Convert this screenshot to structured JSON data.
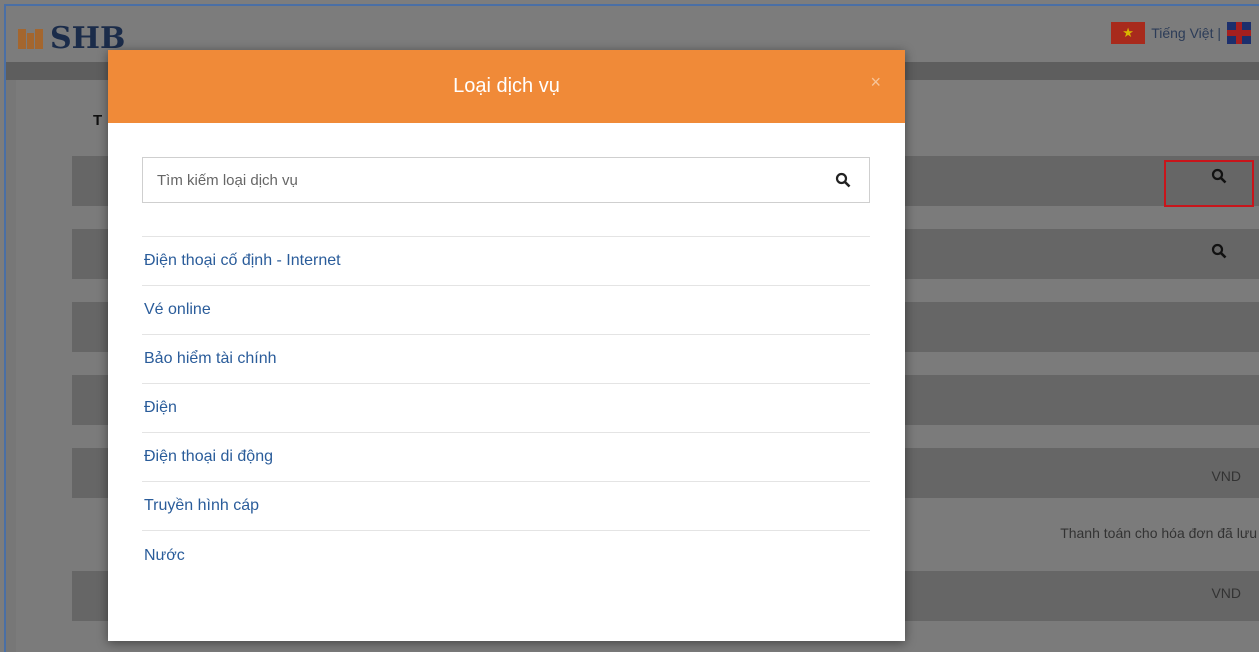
{
  "header": {
    "logo_text": "SHB",
    "language_label": "Tiếng Việt |"
  },
  "background": {
    "breadcrumb": "T",
    "rows": [
      {
        "text": ""
      },
      {
        "text": ""
      },
      {
        "text": ""
      },
      {
        "text": ""
      },
      {
        "text": "VND"
      },
      {
        "text": "Thanh toán cho hóa đơn đã lưu"
      },
      {
        "text": "VND"
      }
    ]
  },
  "modal": {
    "title": "Loại dịch vụ",
    "close": "×",
    "search": {
      "placeholder": "Tìm kiếm loại dịch vụ",
      "value": ""
    },
    "services": [
      "Điện thoại cố định - Internet",
      "Vé online",
      "Bảo hiểm tài chính",
      "Điện",
      "Điện thoại di động",
      "Truyền hình cáp",
      "Nước"
    ]
  },
  "colors": {
    "modal_header": "#f08a38",
    "link": "#2a5c9a",
    "highlight_box": "#c8151b"
  },
  "icons": {
    "search": "search-icon",
    "close": "close-icon"
  }
}
